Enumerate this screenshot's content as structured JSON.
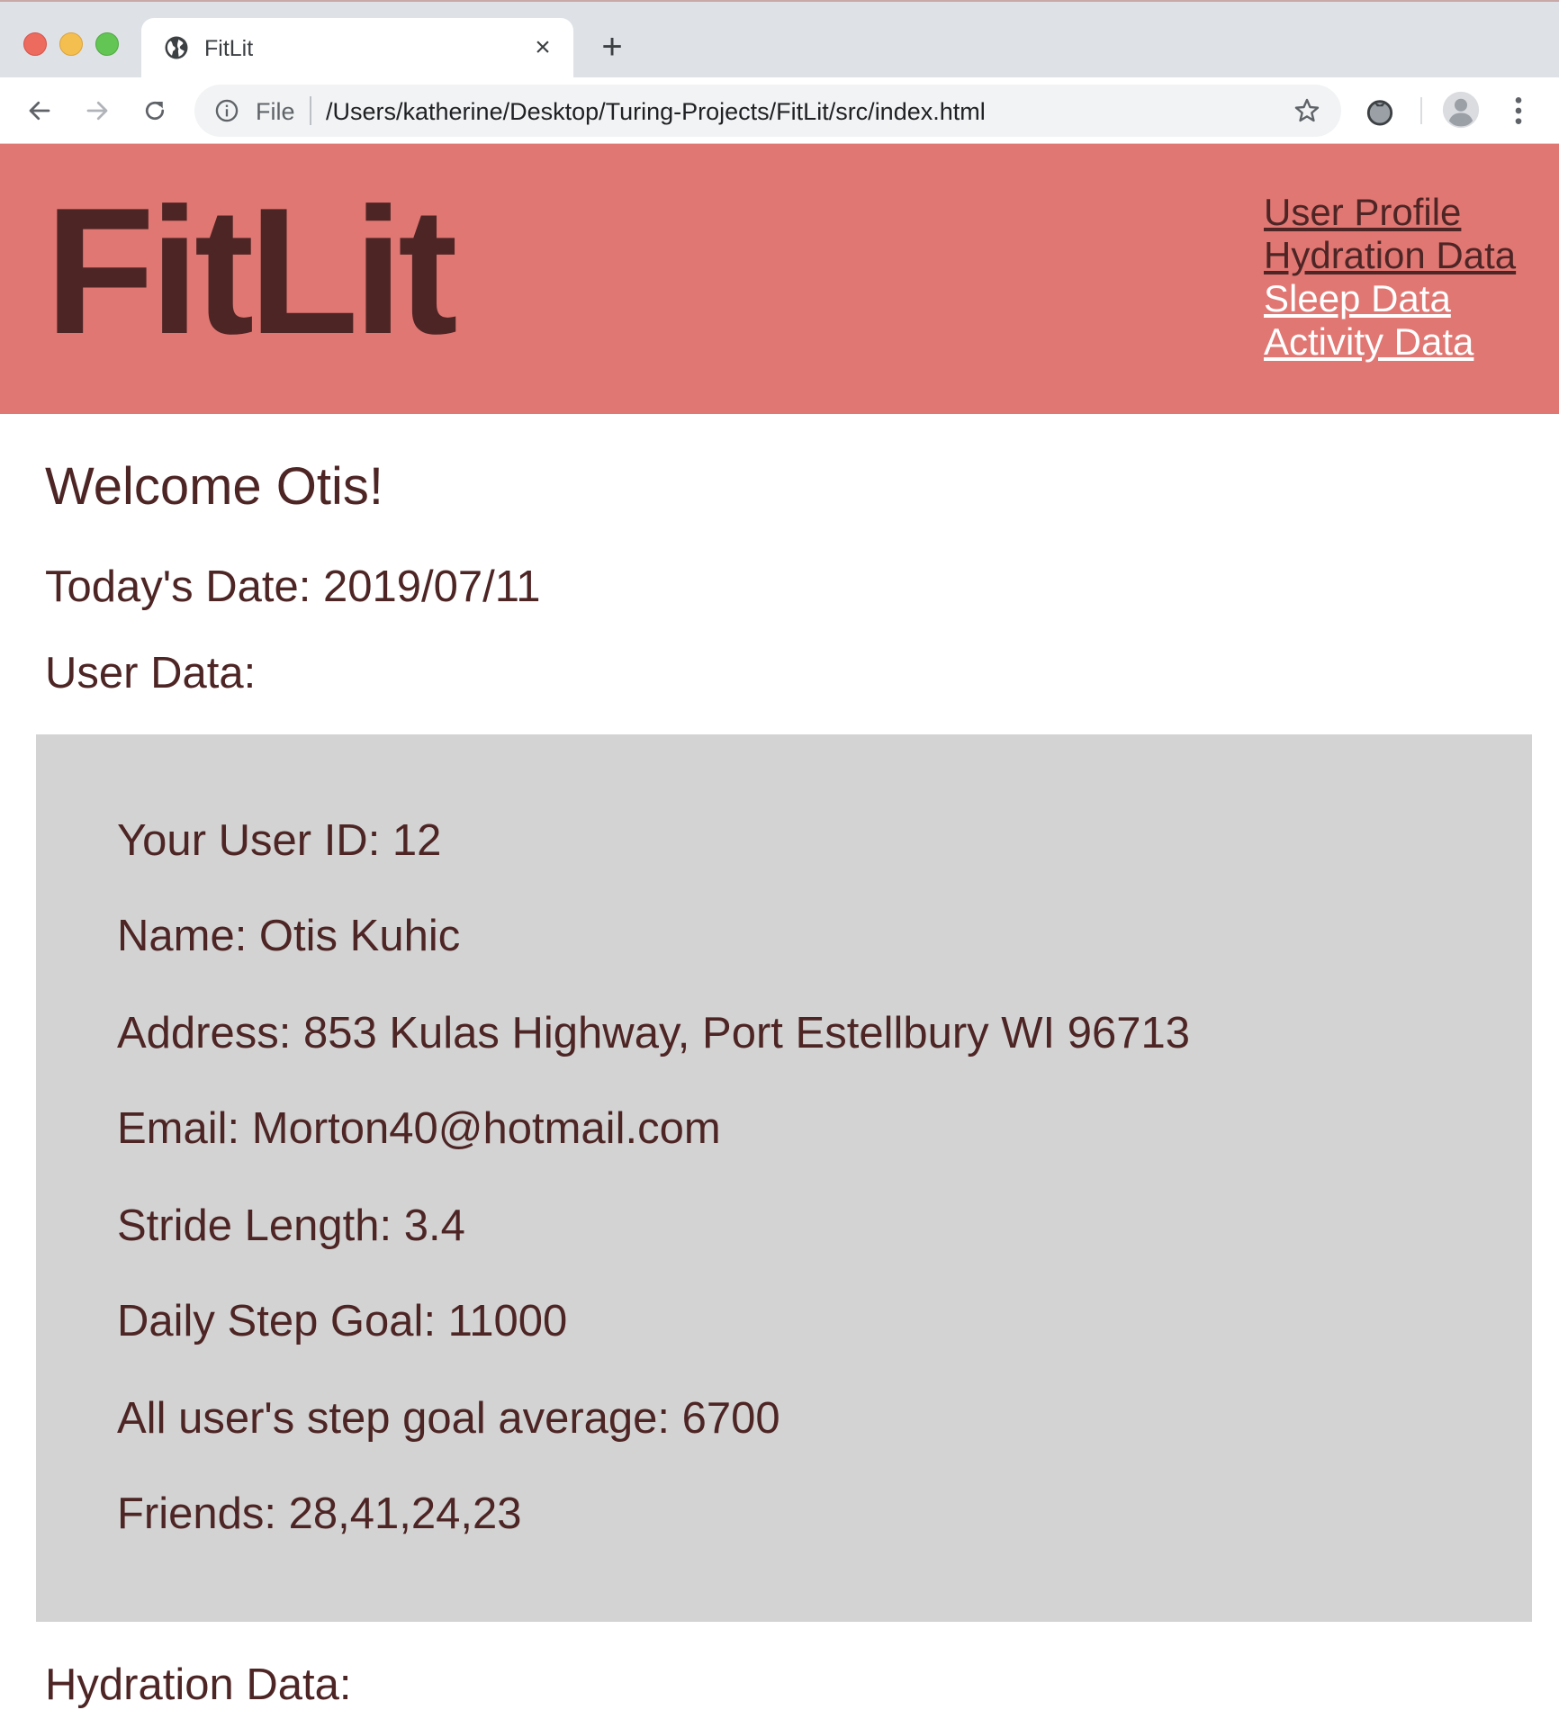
{
  "browser": {
    "tab_title": "FitLit",
    "new_tab_symbol": "+",
    "close_symbol": "×",
    "address_scheme": "File",
    "address_url": "/Users/katherine/Desktop/Turing-Projects/FitLit/src/index.html"
  },
  "header": {
    "logo": "FitLit",
    "nav": {
      "user_profile": "User Profile",
      "hydration_data": "Hydration Data",
      "sleep_data": "Sleep Data",
      "activity_data": "Activity Data"
    }
  },
  "main": {
    "welcome": "Welcome Otis!",
    "todays_date": "Today's Date: 2019/07/11",
    "user_data_heading": "User Data:",
    "user_card": {
      "user_id": "Your User ID: 12",
      "name": "Name: Otis Kuhic",
      "address": "Address: 853 Kulas Highway, Port Estellbury WI 96713",
      "email": "Email: Morton40@hotmail.com",
      "stride_length": "Stride Length: 3.4",
      "daily_step_goal": "Daily Step Goal: 11000",
      "avg_step_goal": "All user's step goal average: 6700",
      "friends": "Friends: 28,41,24,23"
    },
    "hydration_heading": "Hydration Data:"
  },
  "icons": {
    "favicon": "globe-icon",
    "back": "back-arrow-icon",
    "forward": "forward-arrow-icon",
    "reload": "reload-icon",
    "info": "info-icon",
    "bookmark": "star-icon",
    "extension": "tomato-extension-icon",
    "profile": "profile-icon",
    "menu": "kebab-menu-icon"
  },
  "colors": {
    "header_bg": "#e07773",
    "text_dark": "#4e2525",
    "card_bg": "#d3d3d3"
  }
}
